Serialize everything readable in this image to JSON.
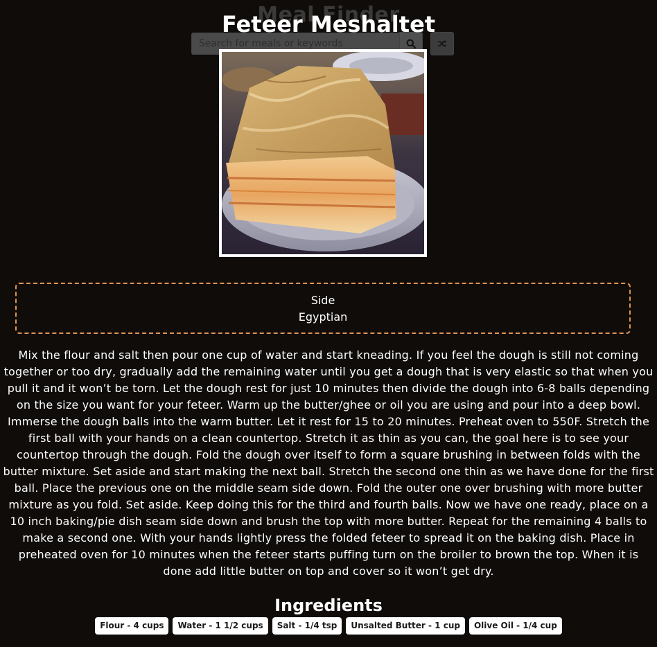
{
  "header": {
    "app_title": "Meal Finder",
    "search": {
      "placeholder": "Search for meals or keywords",
      "value": ""
    },
    "search_button_icon": "search-icon",
    "random_button_icon": "shuffle-icon"
  },
  "meal": {
    "title": "Feteer Meshaltet",
    "category": "Side",
    "area": "Egyptian",
    "instructions": "Mix the flour and salt then pour one cup of water and start kneading. If you feel the dough is still not coming together or too dry, gradually add the remaining water until you get a dough that is very elastic so that when you pull it and it won’t be torn. Let the dough rest for just 10 minutes then divide the dough into 6-8 balls depending on the size you want for your feteer. Warm up the butter/ghee or oil you are using and pour into a deep bowl. Immerse the dough balls into the warm butter. Let it rest for 15 to 20 minutes. Preheat oven to 550F. Stretch the first ball with your hands on a clean countertop. Stretch it as thin as you can, the goal here is to see your countertop through the dough. Fold the dough over itself to form a square brushing in between folds with the butter mixture. Set aside and start making the next ball. Stretch the second one thin as we have done for the first ball. Place the previous one on the middle seam side down. Fold the outer one over brushing with more butter mixture as you fold. Set aside. Keep doing this for the third and fourth balls. Now we have one ready, place on a 10 inch baking/pie dish seam side down and brush the top with more butter. Repeat for the remaining 4 balls to make a second one. With your hands lightly press the folded feteer to spread it on the baking dish. Place in preheated oven for 10 minutes when the feteer starts puffing turn on the broiler to brown the top. When it is done add little butter on top and cover so it won’t get dry.",
    "ingredients_heading": "Ingredients",
    "ingredients": [
      "Flour - 4 cups",
      "Water - 1 1/2 cups",
      "Salt - 1/4 tsp",
      "Unsalted Butter - 1 cup",
      "Olive Oil - 1/4 cup"
    ]
  },
  "colors": {
    "background": "#0f0c0a",
    "info_border": "#e1934f",
    "text": "#ffffff",
    "ingredient_bg": "#ffffff"
  }
}
